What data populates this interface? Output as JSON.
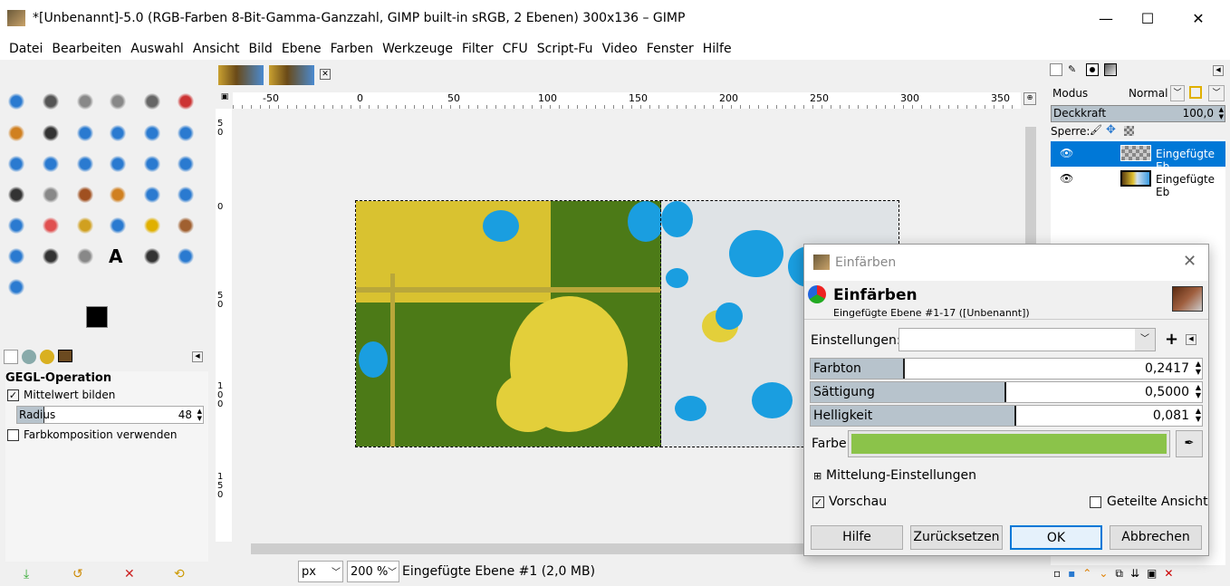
{
  "window": {
    "title": "*[Unbenannt]-5.0 (RGB-Farben 8-Bit-Gamma-Ganzzahl, GIMP built-in sRGB, 2 Ebenen) 300x136 – GIMP",
    "minimize": "—",
    "maximize": "☐",
    "close": "✕"
  },
  "menu": [
    "Datei",
    "Bearbeiten",
    "Auswahl",
    "Ansicht",
    "Bild",
    "Ebene",
    "Farben",
    "Werkzeuge",
    "Filter",
    "CFU",
    "Script-Fu",
    "Video",
    "Fenster",
    "Hilfe"
  ],
  "toolbox": {
    "tools": [
      "move",
      "align",
      "rect-select",
      "ellipse-select",
      "free-select",
      "scissors",
      "foreground-select",
      "fuzzy-select",
      "color-select",
      "crop",
      "unified-transform",
      "warp",
      "perspective",
      "flip",
      "cage",
      "handle-transform",
      "3d-transform",
      "n-point",
      "gradient",
      "blend",
      "paintbrush",
      "pencil",
      "airbrush",
      "ink",
      "mypaint",
      "eraser",
      "clone",
      "heal",
      "smudge",
      "dodge",
      "blur",
      "heal2",
      "path",
      "text",
      "color-picker",
      "measure",
      "zoom"
    ]
  },
  "tool_options": {
    "heading": "GEGL-Operation",
    "mittelwert_label": "Mittelwert bilden",
    "mittelwert_checked": true,
    "radius_label": "Radius",
    "radius_value": "48",
    "farbkomposition_label": "Farbkomposition verwenden",
    "farbkomposition_checked": false
  },
  "ruler": {
    "h": [
      "-50",
      "0",
      "50",
      "100",
      "150",
      "200",
      "250",
      "300",
      "350"
    ],
    "v": [
      "5\n0",
      "0",
      "5\n0",
      "1\n0\n0",
      "1\n5\n0"
    ]
  },
  "status": {
    "unit": "px",
    "zoom": "200 %",
    "info": "Eingefügte Ebene #1 (2,0 MB)"
  },
  "layers": {
    "mode_label": "Modus",
    "mode_value": "Normal",
    "opacity_label": "Deckkraft",
    "opacity_value": "100,0",
    "lock_label": "Sperre:",
    "items": [
      {
        "name": "Eingefügte Eb",
        "selected": true
      },
      {
        "name": "Eingefügte Eb",
        "selected": false
      }
    ]
  },
  "dialog": {
    "window_title": "Einfärben",
    "title": "Einfärben",
    "subtitle": "Eingefügte Ebene #1-17 ([Unbenannt])",
    "settings_label": "Einstellungen:",
    "settings_value": "",
    "plus": "+",
    "farbton_label": "Farbton",
    "farbton_value": "0,2417",
    "farbton_fraction": 0.2417,
    "saettigung_label": "Sättigung",
    "saettigung_value": "0,5000",
    "saettigung_fraction": 0.5,
    "helligkeit_label": "Helligkeit",
    "helligkeit_value": "0,081",
    "farbe_label": "Farbe",
    "farbe_color": "#8bc34a",
    "mittelung_label": "Mittelung-Einstellungen",
    "vorschau_label": "Vorschau",
    "vorschau_checked": true,
    "geteilte_label": "Geteilte Ansicht",
    "geteilte_checked": false,
    "buttons": {
      "help": "Hilfe",
      "reset": "Zurücksetzen",
      "ok": "OK",
      "cancel": "Abbrechen"
    }
  }
}
